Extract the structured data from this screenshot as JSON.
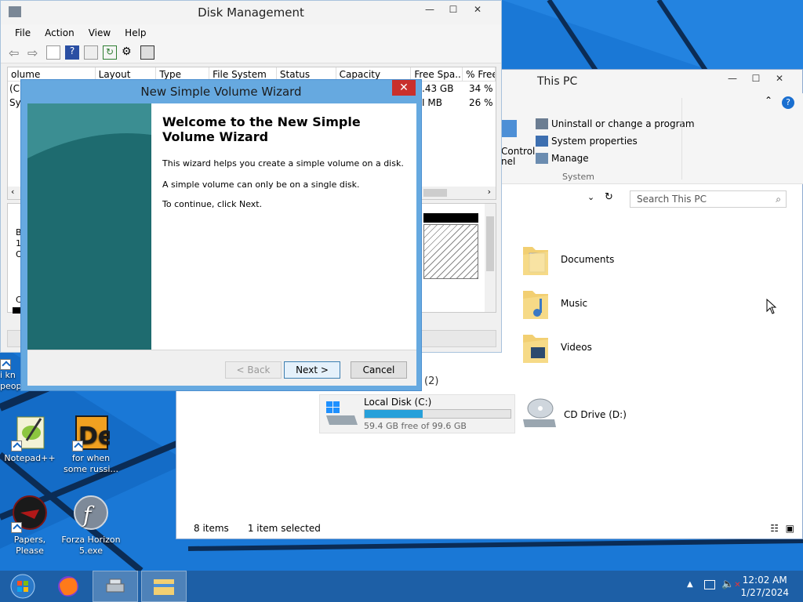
{
  "disk_management": {
    "title": "Disk Management",
    "menu": [
      "File",
      "Action",
      "View",
      "Help"
    ],
    "columns": [
      "olume",
      "Layout",
      "Type",
      "File System",
      "Status",
      "Capacity",
      "Free Spa...",
      "% Free"
    ],
    "rows": [
      {
        "col0": "(C",
        "free": ".43 GB",
        "pct": "34 %"
      },
      {
        "col0": "Sys",
        "free": "I MB",
        "pct": "26 %"
      }
    ]
  },
  "wizard": {
    "title": "New Simple Volume Wizard",
    "close": "✕",
    "heading": "Welcome to the New Simple Volume Wizard",
    "para1": "This wizard helps you create a simple volume on a disk.",
    "para2": "A simple volume can only be on a single disk.",
    "para3": "To continue, click Next.",
    "back": "< Back",
    "next": "Next >",
    "cancel": "Cancel"
  },
  "this_pc": {
    "title": "This PC",
    "ribbon": {
      "uninstall": "Uninstall or change a program",
      "system_properties": "System properties",
      "manage": "Manage",
      "group": "System",
      "control_panel_1": "Control",
      "control_panel_2": "nel"
    },
    "search_placeholder": "Search This PC",
    "folders": [
      "Documents",
      "Music",
      "Videos"
    ],
    "devices_header": "(2)",
    "local_disk": {
      "name": "Local Disk (C:)",
      "free": "59.4 GB free of 99.6 GB",
      "used_fraction": 0.4
    },
    "cd_drive": "CD Drive (D:)",
    "status_items": "8 items",
    "status_selected": "1 item selected"
  },
  "desktop_icons": [
    {
      "label": "i kn\npeop"
    },
    {
      "label": "Notepad++"
    },
    {
      "label": "for when some russi..."
    },
    {
      "label": "Papers, Please"
    },
    {
      "label": "Forza Horizon 5.exe"
    }
  ],
  "taskbar": {
    "time": "12:02 AM",
    "date": "1/27/2024"
  }
}
